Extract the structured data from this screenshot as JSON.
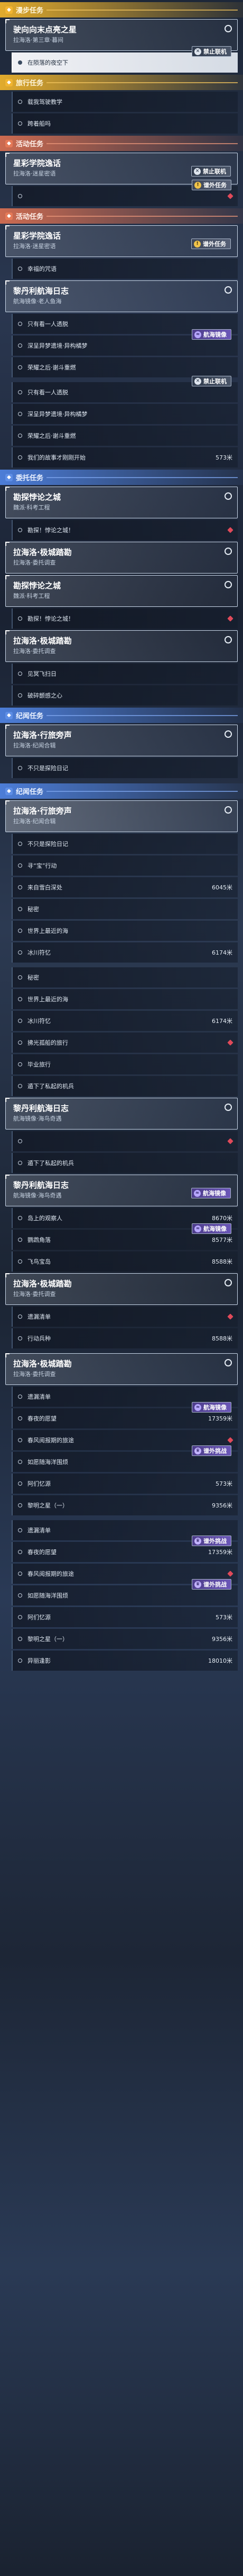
{
  "icons": {
    "offline": "lock-icon",
    "stream": "wave-icon",
    "danger": "warning-icon",
    "elite": "crown-icon"
  },
  "badges": {
    "offline": "禁止联机",
    "stream": "航海镜像",
    "danger": "谱外任务",
    "elite": "谱外挑战"
  },
  "sections": [
    {
      "type": "header",
      "theme": "yellow",
      "title": "漫步任务"
    },
    {
      "type": "card",
      "title": "驶向向末点亮之星",
      "subtitle": "拉海洛·第三章·暮间"
    },
    {
      "type": "row",
      "label": "在陨落的夜空下",
      "active": true,
      "badge": "offline"
    },
    {
      "type": "header",
      "theme": "yellow",
      "title": "旅行任务"
    },
    {
      "type": "row",
      "label": "载我驾驶教学"
    },
    {
      "type": "row",
      "label": "跨着船吗"
    },
    {
      "type": "header",
      "theme": "red",
      "title": "活动任务"
    },
    {
      "type": "card",
      "title": "星彩学院逸话",
      "subtitle": "拉海洛·迷星密语",
      "badge": "offline"
    },
    {
      "type": "row",
      "label": "",
      "badge": "danger",
      "diamond": true
    },
    {
      "type": "header",
      "theme": "red",
      "title": "活动任务"
    },
    {
      "type": "card",
      "title": "星彩学院逸话",
      "subtitle": "拉海洛·迷星密语",
      "badge": "danger"
    },
    {
      "type": "row",
      "label": "幸福的咒语"
    },
    {
      "type": "card",
      "title": "黎丹利航海日志",
      "subtitle": "航海镜像·老人鱼海"
    },
    {
      "type": "row",
      "label": "只有看一人透脱"
    },
    {
      "type": "row",
      "label": "深呈异梦遗境·异构橘梦",
      "badge": "stream"
    },
    {
      "type": "row",
      "label": "荣耀之后·谢斗重燃"
    },
    {
      "type": "gap"
    },
    {
      "type": "row",
      "label": "只有看一人透脱",
      "badge": "offline"
    },
    {
      "type": "row",
      "label": "深呈异梦遗境·异构橘梦"
    },
    {
      "type": "row",
      "label": "荣耀之后·谢斗重燃"
    },
    {
      "type": "row",
      "label": "我们的故事才刚刚开始",
      "dist": "573米"
    },
    {
      "type": "header",
      "theme": "blue",
      "title": "委托任务"
    },
    {
      "type": "card",
      "title": "勘探悖论之城",
      "subtitle": "魏派·科考工程"
    },
    {
      "type": "row",
      "label": "勘探！悖论之城！",
      "diamond": true
    },
    {
      "type": "card",
      "title": "拉海洛·极城踏勘",
      "subtitle": "拉海洛·委托调查"
    },
    {
      "type": "card",
      "title": "勘探悖论之城",
      "subtitle": "魏派·科考工程"
    },
    {
      "type": "row",
      "label": "勘探！悖论之城！",
      "diamond": true
    },
    {
      "type": "card",
      "title": "拉海洛·极城踏勘",
      "subtitle": "拉海洛·委托调查"
    },
    {
      "type": "row",
      "label": "见冥飞扫日"
    },
    {
      "type": "row",
      "label": "破碎颤感之心"
    },
    {
      "type": "header",
      "theme": "blue",
      "title": "纪闻任务"
    },
    {
      "type": "card",
      "title": "拉海洛·行旅旁声",
      "subtitle": "拉海洛·纪闻合辑"
    },
    {
      "type": "row",
      "label": "不只是探险日记"
    },
    {
      "type": "gap"
    },
    {
      "type": "header",
      "theme": "blue",
      "title": "纪闻任务"
    },
    {
      "type": "card",
      "title": "拉海洛·行旅旁声",
      "subtitle": "拉海洛·纪闻合辑",
      "tracked": true
    },
    {
      "type": "row",
      "label": "不只是探险日记"
    },
    {
      "type": "row",
      "label": "寻“宝”行动"
    },
    {
      "type": "row",
      "label": "来自雪白深处",
      "dist": "6045米"
    },
    {
      "type": "row",
      "label": "秘密"
    },
    {
      "type": "row",
      "label": "世界上最近的海"
    },
    {
      "type": "row",
      "label": "冰川符忆",
      "dist": "6174米"
    },
    {
      "type": "gap"
    },
    {
      "type": "row",
      "label": "秘密"
    },
    {
      "type": "row",
      "label": "世界上最近的海"
    },
    {
      "type": "row",
      "label": "冰川符忆",
      "dist": "6174米"
    },
    {
      "type": "row",
      "label": "拂光孤船的旅行",
      "diamond": true
    },
    {
      "type": "row",
      "label": "毕业旅行"
    },
    {
      "type": "row",
      "label": "遁下了私起的机兵"
    },
    {
      "type": "card",
      "title": "黎丹利航海日志",
      "subtitle": "航海镜像·海鸟奇遇"
    },
    {
      "type": "row",
      "label": "",
      "diamond": true
    },
    {
      "type": "row",
      "label": "遁下了私起的机兵"
    },
    {
      "type": "card",
      "title": "黎丹利航海日志",
      "subtitle": "航海镜像·海鸟奇遇",
      "badge": "stream"
    },
    {
      "type": "row",
      "label": "岛上的观察人",
      "dist": "8670米"
    },
    {
      "type": "row",
      "label": "鹦鹉角落",
      "dist": "8577米",
      "badge": "stream"
    },
    {
      "type": "row",
      "label": "飞鸟宝岛",
      "dist": "8588米"
    },
    {
      "type": "card",
      "title": "拉海洛·极城踏勘",
      "subtitle": "拉海洛·委托调查"
    },
    {
      "type": "row",
      "label": "遗漏清单",
      "diamond": true
    },
    {
      "type": "row",
      "label": "行动兵种",
      "dist": "8588米"
    },
    {
      "type": "gap"
    },
    {
      "type": "card",
      "title": "拉海洛·极城踏勘",
      "subtitle": "拉海洛·委托调查"
    },
    {
      "type": "row",
      "label": "遗漏清单"
    },
    {
      "type": "row",
      "label": "春夜的愿望",
      "dist": "17359米",
      "badge": "stream"
    },
    {
      "type": "row",
      "label": "春风阅报期的旅途",
      "diamond": true
    },
    {
      "type": "row",
      "label": "如愿随海洋围烦",
      "badge": "elite"
    },
    {
      "type": "row",
      "label": "阿们忆源",
      "dist": "573米"
    },
    {
      "type": "row",
      "label": "黎明之星（一）",
      "dist": "9356米"
    },
    {
      "type": "gap"
    },
    {
      "type": "row",
      "label": "遗漏清单"
    },
    {
      "type": "row",
      "label": "春夜的愿望",
      "dist": "17359米",
      "badge": "elite"
    },
    {
      "type": "row",
      "label": "春风阅报期的旅途",
      "diamond": true
    },
    {
      "type": "row",
      "label": "如愿随海洋围烦",
      "badge": "elite"
    },
    {
      "type": "row",
      "label": "阿们忆源",
      "dist": "573米"
    },
    {
      "type": "row",
      "label": "黎明之星（一）",
      "dist": "9356米"
    },
    {
      "type": "row",
      "label": "异丽逢影",
      "dist": "18010米"
    }
  ]
}
